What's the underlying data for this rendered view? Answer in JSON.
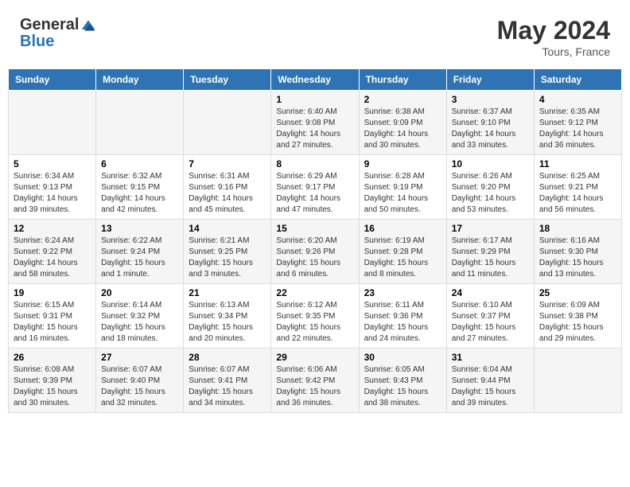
{
  "header": {
    "logo_general": "General",
    "logo_blue": "Blue",
    "month_year": "May 2024",
    "location": "Tours, France"
  },
  "days_of_week": [
    "Sunday",
    "Monday",
    "Tuesday",
    "Wednesday",
    "Thursday",
    "Friday",
    "Saturday"
  ],
  "weeks": [
    {
      "row_bg": "#f5f5f5",
      "days": [
        {
          "number": "",
          "info": ""
        },
        {
          "number": "",
          "info": ""
        },
        {
          "number": "",
          "info": ""
        },
        {
          "number": "1",
          "info": "Sunrise: 6:40 AM\nSunset: 9:08 PM\nDaylight: 14 hours and 27 minutes."
        },
        {
          "number": "2",
          "info": "Sunrise: 6:38 AM\nSunset: 9:09 PM\nDaylight: 14 hours and 30 minutes."
        },
        {
          "number": "3",
          "info": "Sunrise: 6:37 AM\nSunset: 9:10 PM\nDaylight: 14 hours and 33 minutes."
        },
        {
          "number": "4",
          "info": "Sunrise: 6:35 AM\nSunset: 9:12 PM\nDaylight: 14 hours and 36 minutes."
        }
      ]
    },
    {
      "row_bg": "#fff",
      "days": [
        {
          "number": "5",
          "info": "Sunrise: 6:34 AM\nSunset: 9:13 PM\nDaylight: 14 hours and 39 minutes."
        },
        {
          "number": "6",
          "info": "Sunrise: 6:32 AM\nSunset: 9:15 PM\nDaylight: 14 hours and 42 minutes."
        },
        {
          "number": "7",
          "info": "Sunrise: 6:31 AM\nSunset: 9:16 PM\nDaylight: 14 hours and 45 minutes."
        },
        {
          "number": "8",
          "info": "Sunrise: 6:29 AM\nSunset: 9:17 PM\nDaylight: 14 hours and 47 minutes."
        },
        {
          "number": "9",
          "info": "Sunrise: 6:28 AM\nSunset: 9:19 PM\nDaylight: 14 hours and 50 minutes."
        },
        {
          "number": "10",
          "info": "Sunrise: 6:26 AM\nSunset: 9:20 PM\nDaylight: 14 hours and 53 minutes."
        },
        {
          "number": "11",
          "info": "Sunrise: 6:25 AM\nSunset: 9:21 PM\nDaylight: 14 hours and 56 minutes."
        }
      ]
    },
    {
      "row_bg": "#f5f5f5",
      "days": [
        {
          "number": "12",
          "info": "Sunrise: 6:24 AM\nSunset: 9:22 PM\nDaylight: 14 hours and 58 minutes."
        },
        {
          "number": "13",
          "info": "Sunrise: 6:22 AM\nSunset: 9:24 PM\nDaylight: 15 hours and 1 minute."
        },
        {
          "number": "14",
          "info": "Sunrise: 6:21 AM\nSunset: 9:25 PM\nDaylight: 15 hours and 3 minutes."
        },
        {
          "number": "15",
          "info": "Sunrise: 6:20 AM\nSunset: 9:26 PM\nDaylight: 15 hours and 6 minutes."
        },
        {
          "number": "16",
          "info": "Sunrise: 6:19 AM\nSunset: 9:28 PM\nDaylight: 15 hours and 8 minutes."
        },
        {
          "number": "17",
          "info": "Sunrise: 6:17 AM\nSunset: 9:29 PM\nDaylight: 15 hours and 11 minutes."
        },
        {
          "number": "18",
          "info": "Sunrise: 6:16 AM\nSunset: 9:30 PM\nDaylight: 15 hours and 13 minutes."
        }
      ]
    },
    {
      "row_bg": "#fff",
      "days": [
        {
          "number": "19",
          "info": "Sunrise: 6:15 AM\nSunset: 9:31 PM\nDaylight: 15 hours and 16 minutes."
        },
        {
          "number": "20",
          "info": "Sunrise: 6:14 AM\nSunset: 9:32 PM\nDaylight: 15 hours and 18 minutes."
        },
        {
          "number": "21",
          "info": "Sunrise: 6:13 AM\nSunset: 9:34 PM\nDaylight: 15 hours and 20 minutes."
        },
        {
          "number": "22",
          "info": "Sunrise: 6:12 AM\nSunset: 9:35 PM\nDaylight: 15 hours and 22 minutes."
        },
        {
          "number": "23",
          "info": "Sunrise: 6:11 AM\nSunset: 9:36 PM\nDaylight: 15 hours and 24 minutes."
        },
        {
          "number": "24",
          "info": "Sunrise: 6:10 AM\nSunset: 9:37 PM\nDaylight: 15 hours and 27 minutes."
        },
        {
          "number": "25",
          "info": "Sunrise: 6:09 AM\nSunset: 9:38 PM\nDaylight: 15 hours and 29 minutes."
        }
      ]
    },
    {
      "row_bg": "#f5f5f5",
      "days": [
        {
          "number": "26",
          "info": "Sunrise: 6:08 AM\nSunset: 9:39 PM\nDaylight: 15 hours and 30 minutes."
        },
        {
          "number": "27",
          "info": "Sunrise: 6:07 AM\nSunset: 9:40 PM\nDaylight: 15 hours and 32 minutes."
        },
        {
          "number": "28",
          "info": "Sunrise: 6:07 AM\nSunset: 9:41 PM\nDaylight: 15 hours and 34 minutes."
        },
        {
          "number": "29",
          "info": "Sunrise: 6:06 AM\nSunset: 9:42 PM\nDaylight: 15 hours and 36 minutes."
        },
        {
          "number": "30",
          "info": "Sunrise: 6:05 AM\nSunset: 9:43 PM\nDaylight: 15 hours and 38 minutes."
        },
        {
          "number": "31",
          "info": "Sunrise: 6:04 AM\nSunset: 9:44 PM\nDaylight: 15 hours and 39 minutes."
        },
        {
          "number": "",
          "info": ""
        }
      ]
    }
  ]
}
